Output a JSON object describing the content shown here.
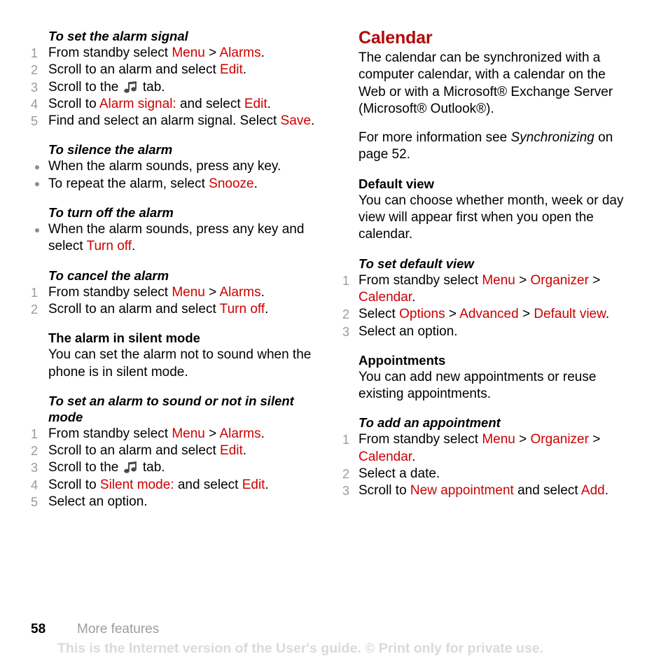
{
  "page": {
    "number": "58",
    "chapter": "More features",
    "watermark": "This is the Internet version of the User's guide. © Print only for private use."
  },
  "icons": {
    "music_note": "music-note-icon"
  },
  "left_column": {
    "blocks": [
      {
        "type": "procedure",
        "title": "To set the alarm signal",
        "steps": [
          {
            "num": "1",
            "parts": [
              {
                "t": "From standby select ",
                "s": "plain"
              },
              {
                "t": "Menu",
                "s": "ui"
              },
              {
                "t": " > ",
                "s": "plain"
              },
              {
                "t": "Alarms",
                "s": "ui"
              },
              {
                "t": ".",
                "s": "plain"
              }
            ]
          },
          {
            "num": "2",
            "parts": [
              {
                "t": "Scroll to an alarm and select ",
                "s": "plain"
              },
              {
                "t": "Edit",
                "s": "ui"
              },
              {
                "t": ".",
                "s": "plain"
              }
            ]
          },
          {
            "num": "3",
            "parts": [
              {
                "t": "Scroll to the ",
                "s": "plain"
              },
              {
                "t": "",
                "s": "note-icon"
              },
              {
                "t": " tab.",
                "s": "plain"
              }
            ]
          },
          {
            "num": "4",
            "parts": [
              {
                "t": "Scroll to ",
                "s": "plain"
              },
              {
                "t": "Alarm signal:",
                "s": "ui"
              },
              {
                "t": " and select ",
                "s": "plain"
              },
              {
                "t": "Edit",
                "s": "ui"
              },
              {
                "t": ".",
                "s": "plain"
              }
            ]
          },
          {
            "num": "5",
            "parts": [
              {
                "t": "Find and select an alarm signal. Select ",
                "s": "plain"
              },
              {
                "t": "Save",
                "s": "ui"
              },
              {
                "t": ".",
                "s": "plain"
              }
            ]
          }
        ]
      },
      {
        "type": "procedure-bullets",
        "title": "To silence the alarm",
        "bullets": [
          {
            "parts": [
              {
                "t": "When the alarm sounds, press any key.",
                "s": "plain"
              }
            ]
          },
          {
            "parts": [
              {
                "t": "To repeat the alarm, select ",
                "s": "plain"
              },
              {
                "t": "Snooze",
                "s": "ui"
              },
              {
                "t": ".",
                "s": "plain"
              }
            ]
          }
        ]
      },
      {
        "type": "procedure-bullets",
        "title": "To turn off the alarm",
        "bullets": [
          {
            "parts": [
              {
                "t": "When the alarm sounds, press any key and select ",
                "s": "plain"
              },
              {
                "t": "Turn off",
                "s": "ui"
              },
              {
                "t": ".",
                "s": "plain"
              }
            ]
          }
        ]
      },
      {
        "type": "procedure",
        "title": "To cancel the alarm",
        "steps": [
          {
            "num": "1",
            "parts": [
              {
                "t": "From standby select ",
                "s": "plain"
              },
              {
                "t": "Menu",
                "s": "ui"
              },
              {
                "t": " > ",
                "s": "plain"
              },
              {
                "t": "Alarms",
                "s": "ui"
              },
              {
                "t": ".",
                "s": "plain"
              }
            ]
          },
          {
            "num": "2",
            "parts": [
              {
                "t": "Scroll to an alarm and select ",
                "s": "plain"
              },
              {
                "t": "Turn off",
                "s": "ui"
              },
              {
                "t": ".",
                "s": "plain"
              }
            ]
          }
        ]
      },
      {
        "type": "subsection",
        "title": "The alarm in silent mode",
        "paragraphs": [
          "You can set the alarm not to sound when the phone is in silent mode."
        ]
      },
      {
        "type": "procedure",
        "title": "To set an alarm to sound or not in silent mode",
        "steps": [
          {
            "num": "1",
            "parts": [
              {
                "t": "From standby select ",
                "s": "plain"
              },
              {
                "t": "Menu",
                "s": "ui"
              },
              {
                "t": " > ",
                "s": "plain"
              },
              {
                "t": "Alarms",
                "s": "ui"
              },
              {
                "t": ".",
                "s": "plain"
              }
            ]
          },
          {
            "num": "2",
            "parts": [
              {
                "t": "Scroll to an alarm and select ",
                "s": "plain"
              },
              {
                "t": "Edit",
                "s": "ui"
              },
              {
                "t": ".",
                "s": "plain"
              }
            ]
          },
          {
            "num": "3",
            "parts": [
              {
                "t": "Scroll to the ",
                "s": "plain"
              },
              {
                "t": "",
                "s": "note-icon"
              },
              {
                "t": " tab.",
                "s": "plain"
              }
            ]
          },
          {
            "num": "4",
            "parts": [
              {
                "t": "Scroll to ",
                "s": "plain"
              },
              {
                "t": "Silent mode:",
                "s": "ui"
              },
              {
                "t": " and select ",
                "s": "plain"
              },
              {
                "t": "Edit",
                "s": "ui"
              },
              {
                "t": ".",
                "s": "plain"
              }
            ]
          },
          {
            "num": "5",
            "parts": [
              {
                "t": "Select an option.",
                "s": "plain"
              }
            ]
          }
        ]
      }
    ]
  },
  "right_column": {
    "blocks": [
      {
        "type": "section",
        "title": "Calendar",
        "paragraphs": [
          "The calendar can be synchronized with a computer calendar, with a calendar on the Web or with a Microsoft® Exchange Server (Microsoft® Outlook®)."
        ]
      },
      {
        "type": "para-rich",
        "parts": [
          {
            "t": "For more information see ",
            "s": "plain"
          },
          {
            "t": " ",
            "s": "plain"
          },
          {
            "t": "Synchronizing",
            "s": "it"
          },
          {
            "t": " on page 52.",
            "s": "plain"
          }
        ]
      },
      {
        "type": "subsection",
        "title": "Default view",
        "paragraphs": [
          "You can choose whether month, week or day view will appear first when you open the calendar."
        ]
      },
      {
        "type": "procedure",
        "title": "To set default view",
        "steps": [
          {
            "num": "1",
            "parts": [
              {
                "t": "From standby select ",
                "s": "plain"
              },
              {
                "t": "Menu",
                "s": "ui"
              },
              {
                "t": " > ",
                "s": "plain"
              },
              {
                "t": "Organizer",
                "s": "ui"
              },
              {
                "t": " > ",
                "s": "plain"
              },
              {
                "t": "Calendar",
                "s": "ui"
              },
              {
                "t": ".",
                "s": "plain"
              }
            ]
          },
          {
            "num": "2",
            "parts": [
              {
                "t": "Select ",
                "s": "plain"
              },
              {
                "t": "Options",
                "s": "ui"
              },
              {
                "t": " > ",
                "s": "plain"
              },
              {
                "t": "Advanced",
                "s": "ui"
              },
              {
                "t": " > ",
                "s": "plain"
              },
              {
                "t": "Default view",
                "s": "ui"
              },
              {
                "t": ".",
                "s": "plain"
              }
            ]
          },
          {
            "num": "3",
            "parts": [
              {
                "t": "Select an option.",
                "s": "plain"
              }
            ]
          }
        ]
      },
      {
        "type": "subsection",
        "title": "Appointments",
        "paragraphs": [
          "You can add new appointments or reuse existing appointments."
        ]
      },
      {
        "type": "procedure",
        "title": "To add an appointment",
        "steps": [
          {
            "num": "1",
            "parts": [
              {
                "t": "From standby select ",
                "s": "plain"
              },
              {
                "t": "Menu",
                "s": "ui"
              },
              {
                "t": " > ",
                "s": "plain"
              },
              {
                "t": "Organizer",
                "s": "ui"
              },
              {
                "t": " > ",
                "s": "plain"
              },
              {
                "t": "Calendar",
                "s": "ui"
              },
              {
                "t": ".",
                "s": "plain"
              }
            ]
          },
          {
            "num": "2",
            "parts": [
              {
                "t": "Select a date.",
                "s": "plain"
              }
            ]
          },
          {
            "num": "3",
            "parts": [
              {
                "t": "Scroll to ",
                "s": "plain"
              },
              {
                "t": "New appointment",
                "s": "ui"
              },
              {
                "t": " and select ",
                "s": "plain"
              },
              {
                "t": "Add",
                "s": "ui"
              },
              {
                "t": ".",
                "s": "plain"
              }
            ]
          }
        ]
      }
    ]
  },
  "colors": {
    "ui_reference": "#cc0000",
    "section_heading": "#b00a0a",
    "list_number": "#9a9a9a",
    "bullet": "#8c8c8c",
    "chapter_name": "#9d9d9d",
    "watermark": "#dadada",
    "body_text": "#000000"
  }
}
